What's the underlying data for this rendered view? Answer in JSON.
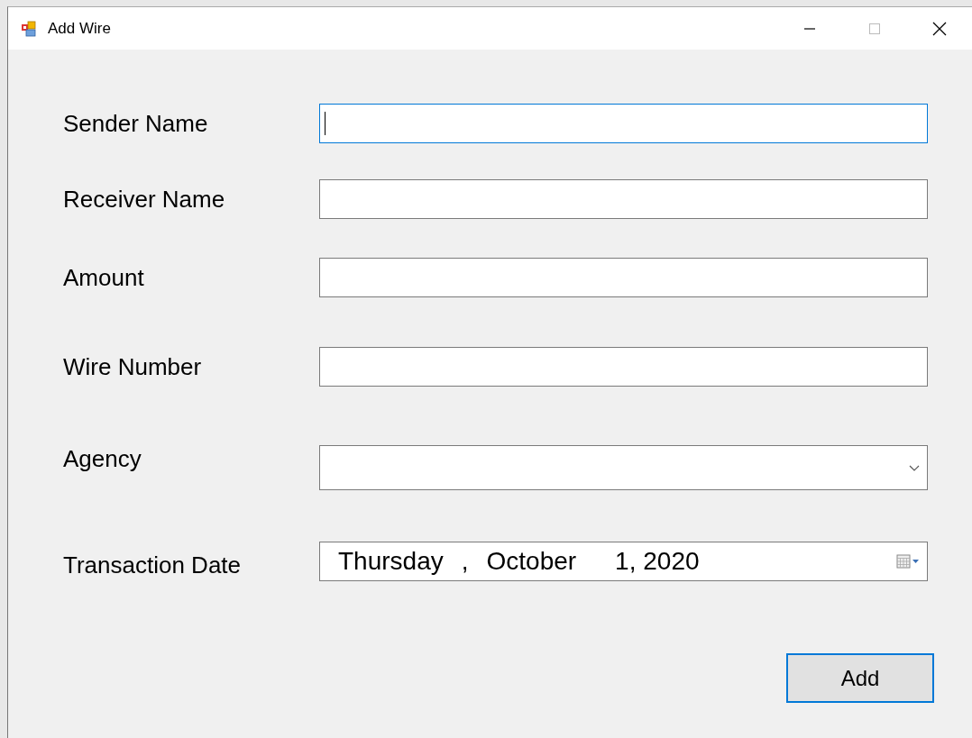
{
  "window": {
    "title": "Add Wire"
  },
  "fields": [
    {
      "kind": "text",
      "label": "Sender Name",
      "focused": true
    },
    {
      "kind": "text",
      "label": "Receiver Name",
      "focused": false
    },
    {
      "kind": "text",
      "label": "Amount",
      "focused": false
    },
    {
      "kind": "text",
      "label": "Wire Number",
      "focused": false
    },
    {
      "kind": "combo",
      "label": "Agency",
      "focused": false
    },
    {
      "kind": "date",
      "label": "Transaction Date",
      "focused": false,
      "parts": [
        "Thursday",
        ",",
        "October",
        "1, 2020"
      ]
    }
  ],
  "buttons": [
    {
      "label": "Add",
      "focused": true
    }
  ]
}
